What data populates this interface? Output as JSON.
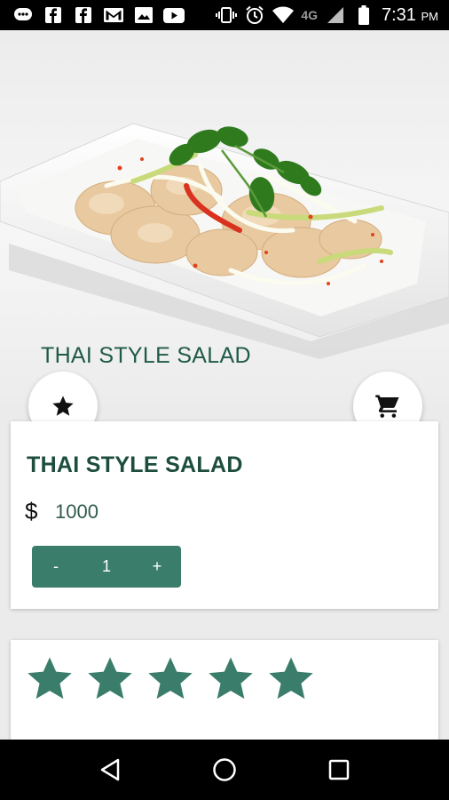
{
  "status_bar": {
    "network": "4G",
    "time": "7:31",
    "ampm": "PM",
    "notification_icons": [
      "chat-icon",
      "facebook-icon",
      "facebook-icon",
      "gmail-icon",
      "image-icon",
      "youtube-icon"
    ],
    "system_icons": [
      "vibrate-icon",
      "alarm-icon",
      "wifi-icon",
      "signal-icon",
      "battery-icon"
    ]
  },
  "hero": {
    "title": "THAI STYLE SALAD",
    "image": "thai-salad-photo"
  },
  "actions": {
    "favorite_icon": "star-icon",
    "cart_icon": "cart-icon"
  },
  "product": {
    "name": "THAI STYLE SALAD",
    "currency": "$",
    "price": "1000",
    "quantity": {
      "decrement": "-",
      "value": "1",
      "increment": "+"
    }
  },
  "rating": {
    "value": 5,
    "max": 5,
    "color": "#3a7d6a"
  },
  "nav": {
    "buttons": [
      "back-icon",
      "home-icon",
      "recents-icon"
    ]
  },
  "colors": {
    "accent": "#3a7d6a",
    "title": "#1f5a48"
  }
}
